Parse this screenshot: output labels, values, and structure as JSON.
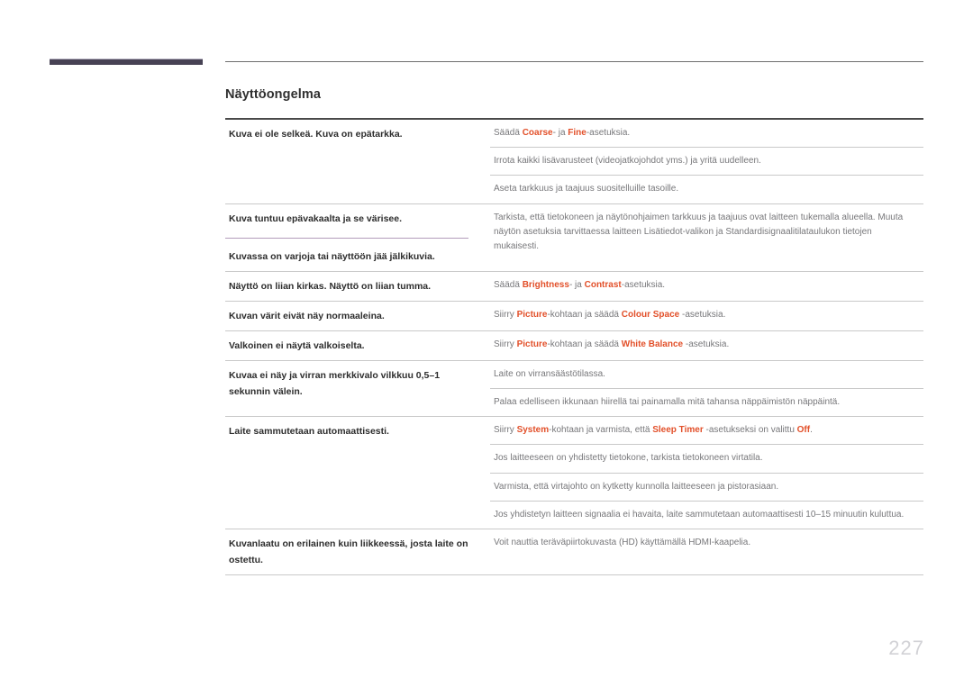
{
  "document": {
    "heading": "Näyttöongelma",
    "page_number": "227",
    "accent_color": "#e2502a",
    "deco_bar_color": "#474254",
    "divider_purple": "#b39cba"
  },
  "table": {
    "sections": [
      {
        "symptom": "Kuva ei ole selkeä. Kuva on epätarkka.",
        "solutions": [
          {
            "parts": [
              {
                "text": "Säädä ",
                "kw": false
              },
              {
                "text": "Coarse",
                "kw": true
              },
              {
                "text": "- ja ",
                "kw": false
              },
              {
                "text": "Fine",
                "kw": true
              },
              {
                "text": "-asetuksia.",
                "kw": false
              }
            ]
          },
          {
            "parts": [
              {
                "text": "Irrota kaikki lisävarusteet (videojatkojohdot yms.) ja yritä uudelleen.",
                "kw": false
              }
            ]
          },
          {
            "parts": [
              {
                "text": "Aseta tarkkuus ja taajuus suositelluille tasoille.",
                "kw": false
              }
            ]
          }
        ]
      },
      {
        "symptom": "Kuva tuntuu epävakaalta ja se värisee.",
        "symptom2": "Kuvassa on varjoja tai näyttöön jää jälkikuvia.",
        "divider": "purple",
        "solutions": [
          {
            "parts": [
              {
                "text": "Tarkista, että tietokoneen ja näytönohjaimen tarkkuus ja taajuus ovat laitteen tukemalla alueella. Muuta näytön asetuksia tarvittaessa laitteen Lisätiedot-valikon ja Standardisignaalitilataulukon tietojen mukaisesti.",
                "kw": false
              }
            ]
          }
        ]
      },
      {
        "symptom": "Näyttö on liian kirkas. Näyttö on liian tumma.",
        "solutions": [
          {
            "parts": [
              {
                "text": "Säädä ",
                "kw": false
              },
              {
                "text": "Brightness",
                "kw": true
              },
              {
                "text": "- ja ",
                "kw": false
              },
              {
                "text": "Contrast",
                "kw": true
              },
              {
                "text": "-asetuksia.",
                "kw": false
              }
            ]
          }
        ]
      },
      {
        "symptom": "Kuvan värit eivät näy normaaleina.",
        "solutions": [
          {
            "parts": [
              {
                "text": "Siirry ",
                "kw": false
              },
              {
                "text": "Picture",
                "kw": true
              },
              {
                "text": "-kohtaan ja säädä ",
                "kw": false
              },
              {
                "text": "Colour Space",
                "kw": true
              },
              {
                "text": " -asetuksia.",
                "kw": false
              }
            ]
          }
        ]
      },
      {
        "symptom": "Valkoinen ei näytä valkoiselta.",
        "solutions": [
          {
            "parts": [
              {
                "text": "Siirry ",
                "kw": false
              },
              {
                "text": "Picture",
                "kw": true
              },
              {
                "text": "-kohtaan ja säädä ",
                "kw": false
              },
              {
                "text": "White Balance",
                "kw": true
              },
              {
                "text": " -asetuksia.",
                "kw": false
              }
            ]
          }
        ]
      },
      {
        "symptom": "Kuvaa ei näy ja virran merkkivalo vilkkuu 0,5–1 sekunnin välein.",
        "solutions": [
          {
            "parts": [
              {
                "text": "Laite on virransäästötilassa.",
                "kw": false
              }
            ]
          },
          {
            "parts": [
              {
                "text": "Palaa edelliseen ikkunaan hiirellä tai painamalla mitä tahansa näppäimistön näppäintä.",
                "kw": false
              }
            ]
          }
        ]
      },
      {
        "symptom": "Laite sammutetaan automaattisesti.",
        "solutions": [
          {
            "parts": [
              {
                "text": "Siirry ",
                "kw": false
              },
              {
                "text": "System",
                "kw": true
              },
              {
                "text": "-kohtaan ja varmista, että ",
                "kw": false
              },
              {
                "text": "Sleep Timer",
                "kw": true
              },
              {
                "text": " -asetukseksi on valittu ",
                "kw": false
              },
              {
                "text": "Off",
                "kw": true
              },
              {
                "text": ".",
                "kw": false
              }
            ]
          },
          {
            "parts": [
              {
                "text": "Jos laitteeseen on yhdistetty tietokone, tarkista tietokoneen virtatila.",
                "kw": false
              }
            ]
          },
          {
            "parts": [
              {
                "text": "Varmista, että virtajohto on kytketty kunnolla laitteeseen ja pistorasiaan.",
                "kw": false
              }
            ]
          },
          {
            "parts": [
              {
                "text": "Jos yhdistetyn laitteen signaalia ei havaita, laite sammutetaan automaattisesti 10–15 minuutin kuluttua.",
                "kw": false
              }
            ]
          }
        ]
      },
      {
        "symptom": "Kuvanlaatu on erilainen kuin liikkeessä, josta laite on ostettu.",
        "solutions": [
          {
            "parts": [
              {
                "text": "Voit nauttia teräväpiirtokuvasta (HD) käyttämällä HDMI-kaapelia.",
                "kw": false
              }
            ]
          }
        ]
      }
    ]
  }
}
